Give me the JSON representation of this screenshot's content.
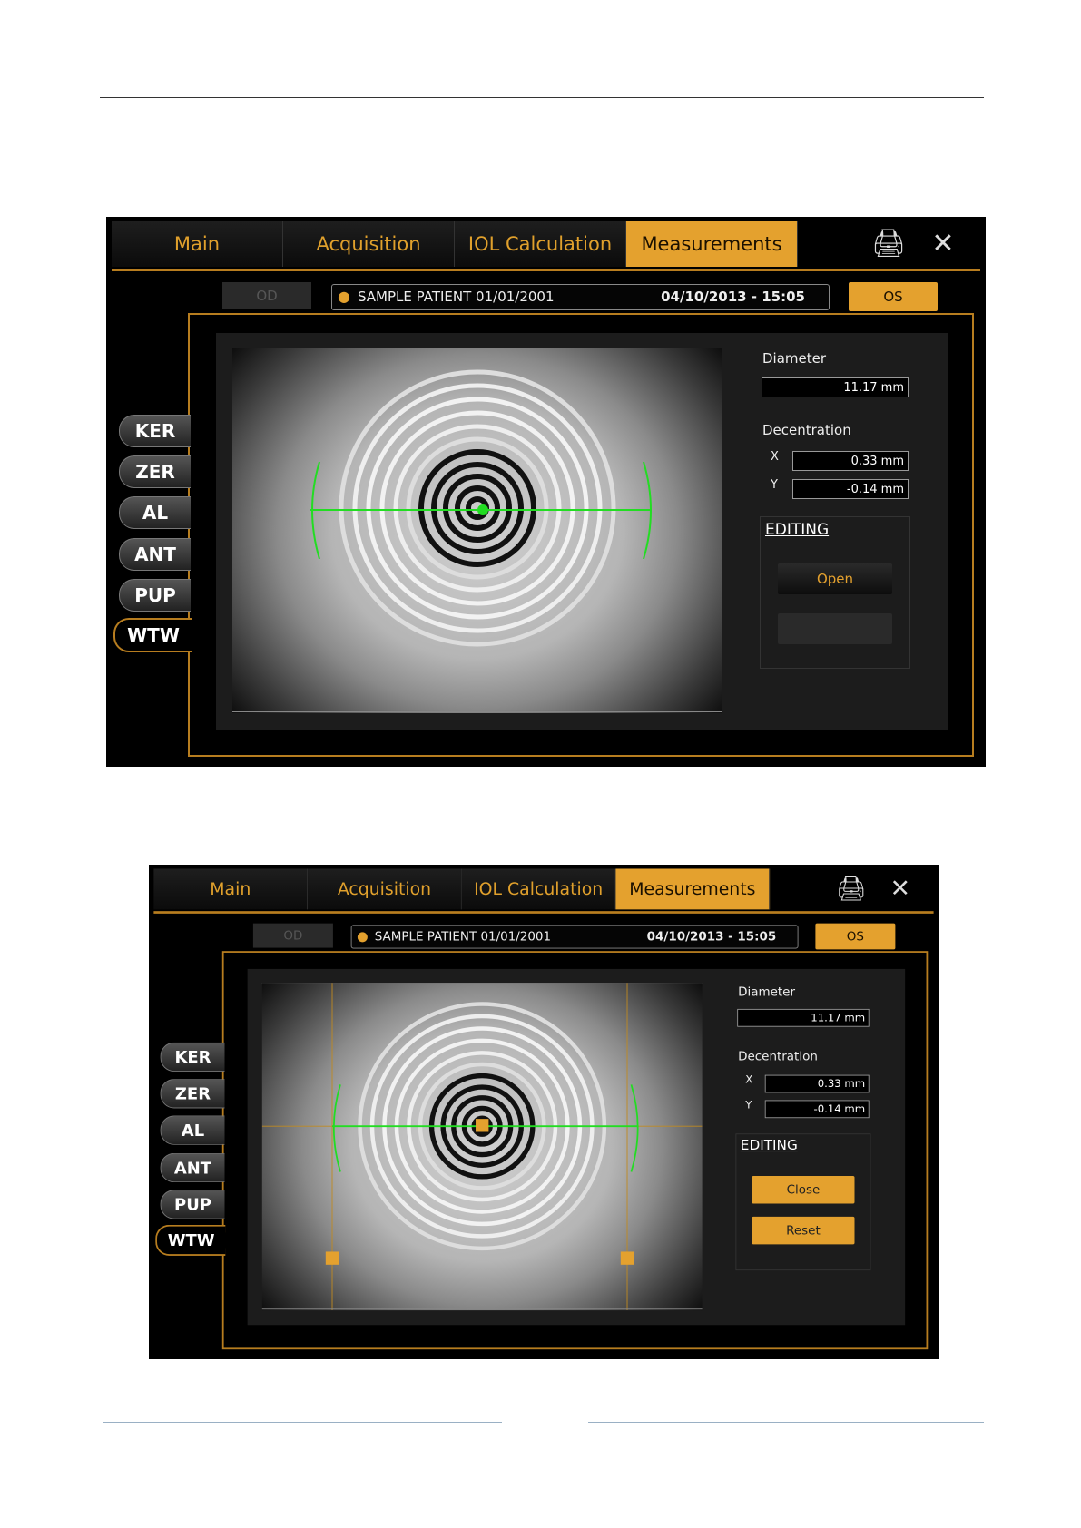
{
  "screens": [
    {
      "tabs": [
        "Main",
        "Acquisition",
        "IOL Calculation",
        "Measurements"
      ],
      "od_label": "OD",
      "patient_name": "SAMPLE PATIENT 01/01/2001",
      "exam_datetime": "04/10/2013 - 15:05",
      "os_label": "OS",
      "side_tabs": [
        "KER",
        "ZER",
        "AL",
        "ANT",
        "PUP",
        "WTW"
      ],
      "diameter_label": "Diameter",
      "diameter_value": "11.17 mm",
      "decentration_label": "Decentration",
      "x_label": "X",
      "x_value": "0.33 mm",
      "y_label": "Y",
      "y_value": "-0.14 mm",
      "editing_label": "EDITING",
      "button1": "Open",
      "button2": ""
    },
    {
      "tabs": [
        "Main",
        "Acquisition",
        "IOL Calculation",
        "Measurements"
      ],
      "od_label": "OD",
      "patient_name": "SAMPLE PATIENT 01/01/2001",
      "exam_datetime": "04/10/2013 - 15:05",
      "os_label": "OS",
      "side_tabs": [
        "KER",
        "ZER",
        "AL",
        "ANT",
        "PUP",
        "WTW"
      ],
      "diameter_label": "Diameter",
      "diameter_value": "11.17 mm",
      "decentration_label": "Decentration",
      "x_label": "X",
      "x_value": "0.33 mm",
      "y_label": "Y",
      "y_value": "-0.14 mm",
      "editing_label": "EDITING",
      "button1": "Close",
      "button2": "Reset"
    }
  ],
  "icons": {
    "print": "printer-icon",
    "tools": "tools-icon",
    "patient": "patient-icon"
  },
  "colors": {
    "accent": "#e4a12e",
    "measure_line": "#22dd22",
    "frame": "#b77d1f"
  }
}
